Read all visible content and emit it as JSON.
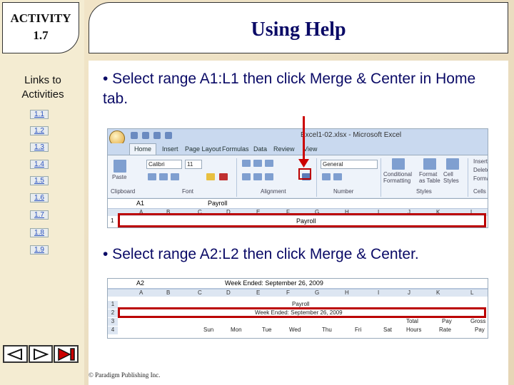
{
  "activity": {
    "label": "ACTIVITY",
    "number": "1.7"
  },
  "title": "Using Help",
  "sidebar": {
    "heading": "Links to Activities",
    "links": [
      "1.1",
      "1.2",
      "1.3",
      "1.4",
      "1.5",
      "1.6",
      "1.7",
      "1.8",
      "1.9"
    ]
  },
  "bullets": [
    "• Select range A1:L1 then click Merge & Center in Home tab.",
    "• Select range A2:L2 then click Merge & Center."
  ],
  "excel1": {
    "window_title": "Excel1-02.xlsx - Microsoft Excel",
    "tabs": [
      "Home",
      "Insert",
      "Page Layout",
      "Formulas",
      "Data",
      "Review",
      "View"
    ],
    "groups": [
      "Clipboard",
      "Font",
      "Alignment",
      "Number",
      "Styles",
      "Cells"
    ],
    "font_name": "Calibri",
    "font_size": "11",
    "number_format": "General",
    "paste_label": "Paste",
    "cond_format_label": "Conditional Formatting",
    "format_table_label": "Format as Table",
    "cell_styles_label": "Cell Styles",
    "insert_label": "Insert",
    "delete_label": "Delete",
    "format_label": "Format",
    "name_box": "A1",
    "formula": "Payroll",
    "columns": [
      "A",
      "B",
      "C",
      "D",
      "E",
      "F",
      "G",
      "H",
      "I",
      "J",
      "K",
      "L"
    ],
    "row1_num": "1",
    "row1_text": "Payroll"
  },
  "excel2": {
    "name_box": "A2",
    "formula": "Week Ended: September 26, 2009",
    "columns": [
      "A",
      "B",
      "C",
      "D",
      "E",
      "F",
      "G",
      "H",
      "I",
      "J",
      "K",
      "L"
    ],
    "rows": [
      {
        "num": "1",
        "text": "Payroll"
      },
      {
        "num": "2",
        "text": "Week Ended: September 26, 2009"
      },
      {
        "num": "3",
        "cells": [
          "Total",
          "Pay",
          "Gross"
        ]
      },
      {
        "num": "4",
        "cells": [
          "Sun",
          "Mon",
          "Tue",
          "Wed",
          "Thu",
          "Fri",
          "Sat",
          "Hours",
          "Rate",
          "Pay"
        ]
      }
    ]
  },
  "copyright": "© Paradigm Publishing Inc.",
  "nav": {
    "prev": "previous-slide",
    "next": "next-slide",
    "end": "last-slide"
  },
  "colors": {
    "title_text": "#0a0a66",
    "highlight": "#b00000",
    "link": "#2a52be"
  }
}
